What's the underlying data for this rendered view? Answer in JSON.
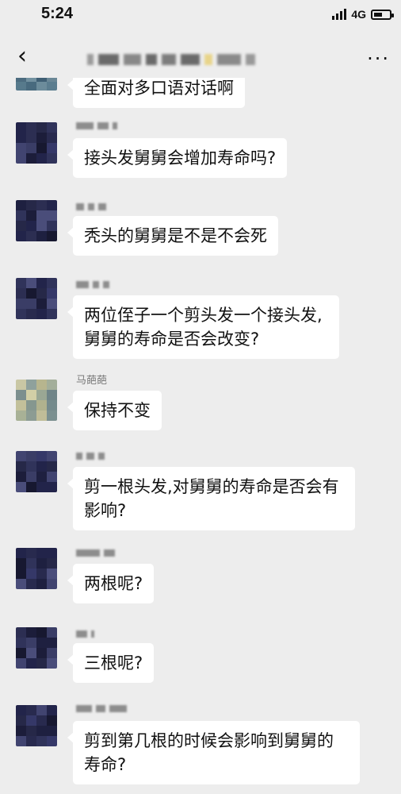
{
  "status_bar": {
    "time": "5:24",
    "network": "4G",
    "battery_level": 0.55
  },
  "nav": {
    "back_icon": "chevron-left-icon",
    "more_icon": "more-icon",
    "more_label": "···"
  },
  "partial_message": {
    "text": "全面对多口语对话啊"
  },
  "messages": [
    {
      "sender_name": "",
      "text": "接头发舅舅会增加寿命吗?"
    },
    {
      "sender_name": "",
      "text": "秃头的舅舅是不是不会死"
    },
    {
      "sender_name": "",
      "text": "两位侄子一个剪头发一个接头发,舅舅的寿命是否会改变?"
    },
    {
      "sender_name": "马葩葩",
      "text": "保持不变"
    },
    {
      "sender_name": "",
      "text": "剪一根头发,对舅舅的寿命是否会有影响?"
    },
    {
      "sender_name": "",
      "text": "两根呢?"
    },
    {
      "sender_name": "",
      "text": "三根呢?"
    },
    {
      "sender_name": "",
      "text": "剪到第几根的时候会影响到舅舅的寿命?"
    }
  ]
}
